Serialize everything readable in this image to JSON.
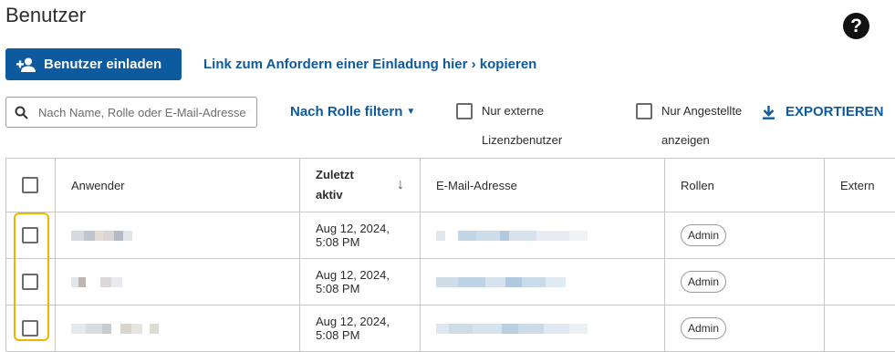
{
  "page": {
    "title": "Benutzer"
  },
  "toolbar": {
    "invite_label": "Benutzer einladen",
    "invite_link": "Link zum Anfordern einer Einladung hier › kopieren"
  },
  "filters": {
    "search_placeholder": "Nach Name, Rolle oder E-Mail-Adresse f",
    "role_filter_label": "Nach Rolle filtern",
    "external_line1": "Nur externe",
    "external_line2": "Lizenzbenutzer",
    "employees_line1": "Nur Angestellte",
    "employees_line2": "anzeigen",
    "export_label": "EXPORTIEREN"
  },
  "table": {
    "columns": {
      "user": "Anwender",
      "last_active_line1": "Zuletzt",
      "last_active_line2": "aktiv",
      "email": "E-Mail-Adresse",
      "roles": "Rollen",
      "external": "Extern"
    },
    "rows": [
      {
        "last_active_line1": "Aug 12, 2024,",
        "last_active_line2": "5:08 PM",
        "role": "Admin"
      },
      {
        "last_active_line1": "Aug 12, 2024,",
        "last_active_line2": "5:08 PM",
        "role": "Admin"
      },
      {
        "last_active_line1": "Aug 12, 2024,",
        "last_active_line2": "5:08 PM",
        "role": "Admin"
      }
    ]
  },
  "colors": {
    "primary": "#0e5a9f",
    "highlight": "#f0b400"
  },
  "icons": [
    "help-icon",
    "add-user-icon",
    "search-icon",
    "caret-down-icon",
    "download-icon",
    "sort-down-icon"
  ]
}
